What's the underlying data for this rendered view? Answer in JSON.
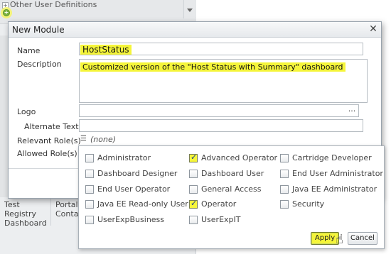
{
  "background": {
    "title": "Other User Definitions",
    "tabs": [
      {
        "label_line1": "Test Registry",
        "label_line2": "Dashboard"
      },
      {
        "label_line1": "Portal",
        "label_line2": "Contain"
      }
    ]
  },
  "dialog": {
    "title": "New Module",
    "close_icon": "close-icon",
    "name_label": "Name",
    "name_value": "HostStatus",
    "description_label": "Description",
    "description_value": "Customized version of the \"Host Status with Summary\" dashboard",
    "logo_label": "Logo",
    "logo_button": "...",
    "alternate_text_label": "Alternate Text",
    "relevant_roles_label": "Relevant Role(s)",
    "relevant_roles_value": "(none)",
    "allowed_roles_label": "Allowed Role(s)"
  },
  "roles_popup": {
    "roles": [
      {
        "label": "Administrator",
        "checked": false
      },
      {
        "label": "Advanced Operator",
        "checked": true
      },
      {
        "label": "Cartridge Developer",
        "checked": false
      },
      {
        "label": "Dashboard Designer",
        "checked": false
      },
      {
        "label": "Dashboard User",
        "checked": false
      },
      {
        "label": "End User Administrator",
        "checked": false
      },
      {
        "label": "End User Operator",
        "checked": false
      },
      {
        "label": "General Access",
        "checked": false
      },
      {
        "label": "Java EE Administrator",
        "checked": false
      },
      {
        "label": "Java EE Read-only User",
        "checked": false
      },
      {
        "label": "Operator",
        "checked": true
      },
      {
        "label": "Security",
        "checked": false
      },
      {
        "label": "UserExpBusiness",
        "checked": false
      },
      {
        "label": "UserExpIT",
        "checked": false
      }
    ],
    "apply_label": "Apply",
    "cancel_label": "Cancel"
  },
  "colors": {
    "highlight": "#f5f53a",
    "check": "#1b3f8a"
  }
}
